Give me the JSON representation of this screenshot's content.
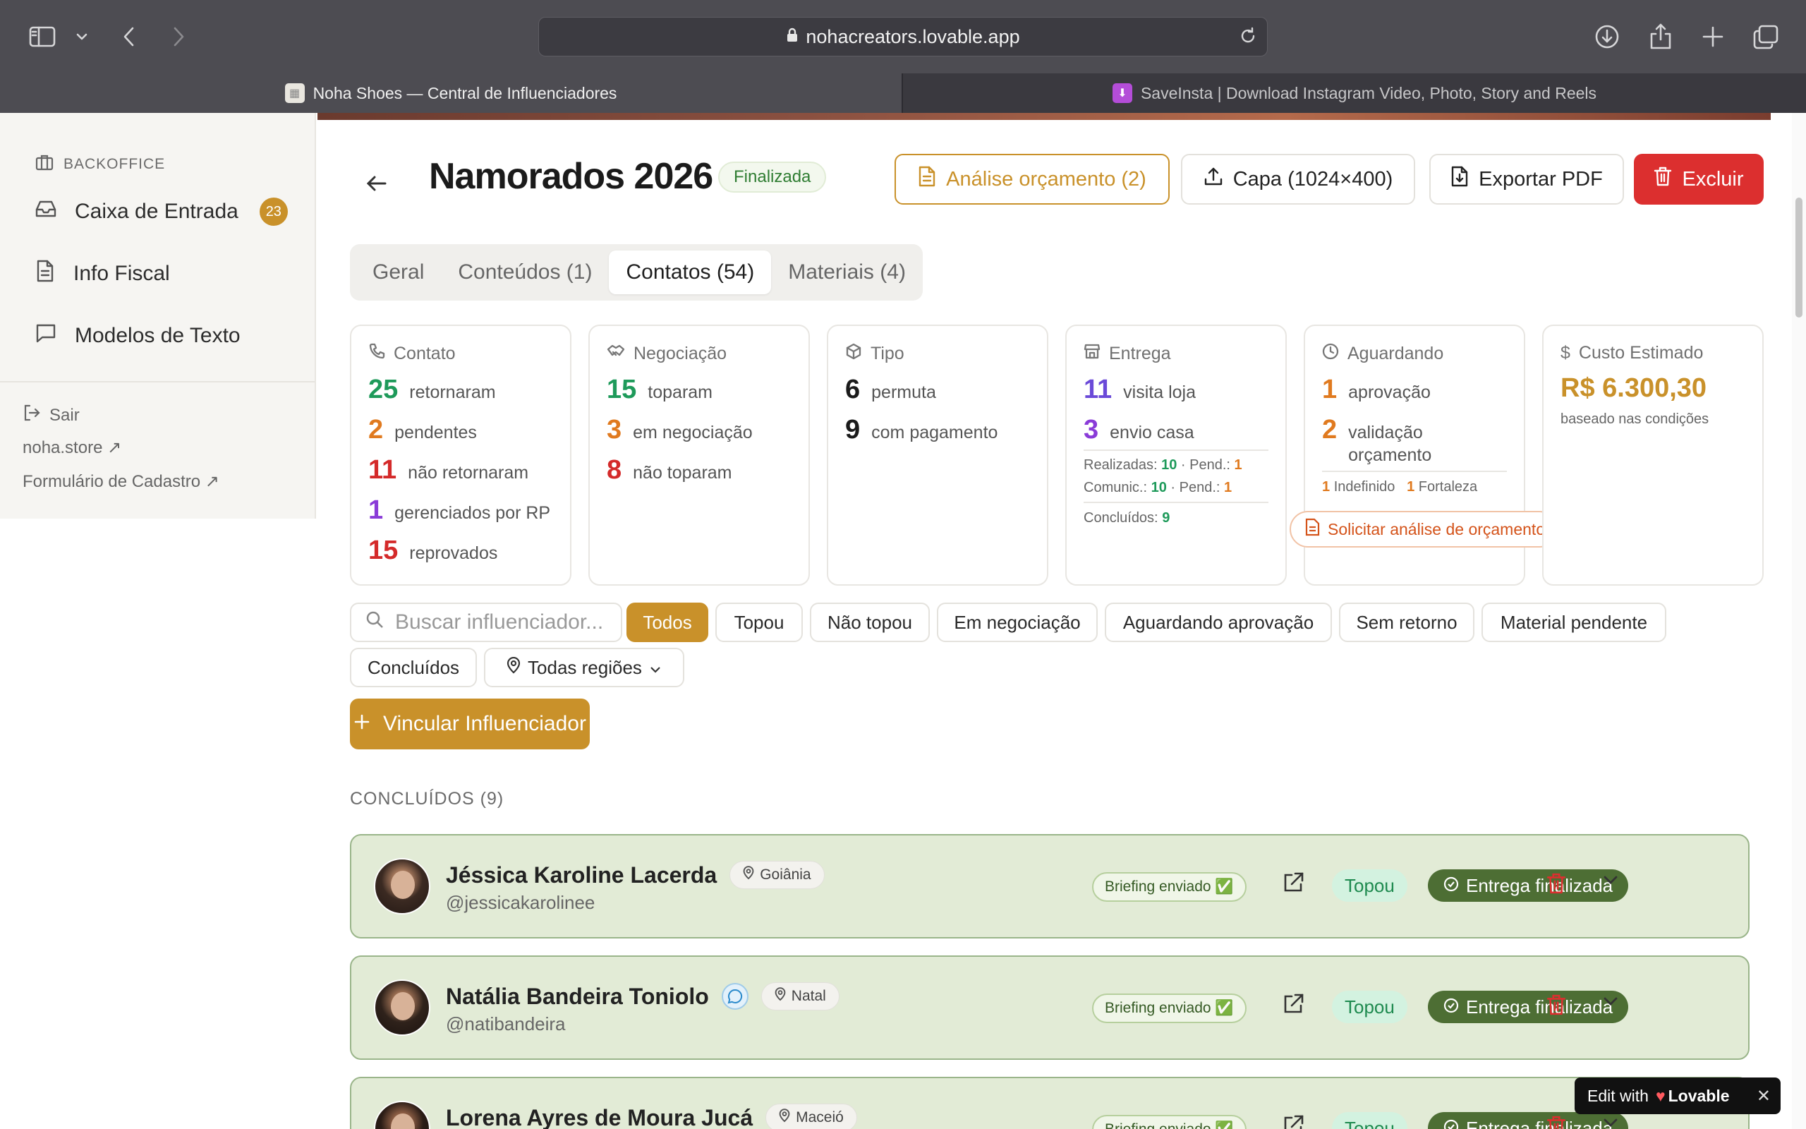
{
  "browser": {
    "url": "nohacreators.lovable.app",
    "tabs": [
      {
        "title": "Noha Shoes — Central de Influenciadores",
        "active": true
      },
      {
        "title": "SaveInsta | Download Instagram Video, Photo, Story and Reels",
        "active": false
      }
    ]
  },
  "sidebar": {
    "section": "BACKOFFICE",
    "items": [
      {
        "label": "Caixa de Entrada",
        "icon": "inbox-icon",
        "badge": "23"
      },
      {
        "label": "Info Fiscal",
        "icon": "document-icon"
      },
      {
        "label": "Modelos de Texto",
        "icon": "message-icon"
      }
    ],
    "logout": "Sair",
    "links": [
      "noha.store ↗",
      "Formulário de Cadastro ↗"
    ]
  },
  "header": {
    "title": "Namorados 2026",
    "status": "Finalizada",
    "buttons": {
      "analysis": "Análise orçamento (2)",
      "cover": "Capa (1024×400)",
      "export": "Exportar PDF",
      "delete": "Excluir"
    }
  },
  "tabs": [
    "Geral",
    "Conteúdos (1)",
    "Contatos (54)",
    "Materiais (4)"
  ],
  "active_tab": "Contatos (54)",
  "cards": {
    "contato": {
      "title": "Contato",
      "stats": [
        {
          "n": "25",
          "label": "retornaram"
        },
        {
          "n": "2",
          "label": "pendentes"
        },
        {
          "n": "11",
          "label": "não retornaram"
        },
        {
          "n": "1",
          "label": "gerenciados por RP"
        },
        {
          "n": "15",
          "label": "reprovados"
        }
      ]
    },
    "negociacao": {
      "title": "Negociação",
      "stats": [
        {
          "n": "15",
          "label": "toparam"
        },
        {
          "n": "3",
          "label": "em negociação"
        },
        {
          "n": "8",
          "label": "não toparam"
        }
      ]
    },
    "tipo": {
      "title": "Tipo",
      "stats": [
        {
          "n": "6",
          "label": "permuta"
        },
        {
          "n": "9",
          "label": "com pagamento"
        }
      ]
    },
    "entrega": {
      "title": "Entrega",
      "stats": [
        {
          "n": "11",
          "label": "visita loja"
        },
        {
          "n": "3",
          "label": "envio casa"
        }
      ],
      "realizadas_label": "Realizadas:",
      "realizadas": "10",
      "pend_label": "· Pend.:",
      "pend1": "1",
      "comunic_label": "Comunic.:",
      "comunic": "10",
      "pend2": "1",
      "concluidos_label": "Concluídos:",
      "concluidos": "9"
    },
    "aguardando": {
      "title": "Aguardando",
      "stats": [
        {
          "n": "1",
          "label": "aprovação"
        },
        {
          "n": "2",
          "label": "validação orçamento"
        }
      ],
      "regions": [
        {
          "n": "1",
          "label": "Indefinido"
        },
        {
          "n": "1",
          "label": "Fortaleza"
        }
      ],
      "request": "Solicitar análise de orçamento"
    },
    "custo": {
      "title": "Custo Estimado",
      "value": "R$ 6.300,30",
      "note": "baseado nas condições"
    }
  },
  "search": {
    "placeholder": "Buscar influenciador..."
  },
  "filters": [
    "Todos",
    "Topou",
    "Não topou",
    "Em negociação",
    "Aguardando aprovação",
    "Sem retorno",
    "Material pendente",
    "Concluídos"
  ],
  "region_filter": "Todas regiões",
  "add_button": "Vincular Influenciador",
  "section_title": "CONCLUÍDOS (9)",
  "rows": [
    {
      "name": "Jéssica Karoline Lacerda",
      "handle": "@jessicakarolinee",
      "city": "Goiânia",
      "briefing": "Briefing enviado ✅",
      "status": "Topou",
      "delivery": "Entrega finalizada"
    },
    {
      "name": "Natália Bandeira Toniolo",
      "handle": "@natibandeira",
      "city": "Natal",
      "briefing": "Briefing enviado ✅",
      "status": "Topou",
      "delivery": "Entrega finalizada"
    },
    {
      "name": "Lorena Ayres de Moura Jucá",
      "handle": "",
      "city": "Maceió",
      "briefing": "Briefing enviado ✅",
      "status": "Topou",
      "delivery": "Entrega finalizada"
    }
  ],
  "lovable": {
    "prefix": "Edit with",
    "brand": "Lovable"
  },
  "colors": {
    "accent": "#c9912a",
    "danger": "#dc2f2f",
    "success": "#1e9a5a",
    "row_bg": "#e2ebd6"
  }
}
